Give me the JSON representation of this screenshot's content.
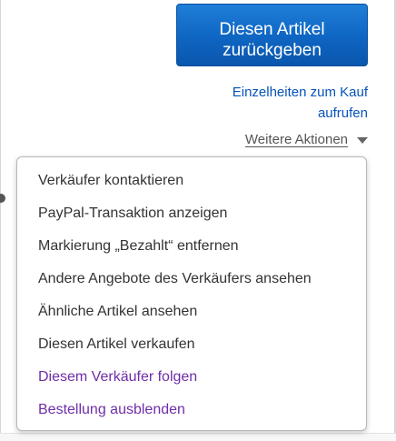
{
  "return_button": {
    "line1": "Diesen Artikel",
    "line2": "zurückgeben"
  },
  "details_link": {
    "line1": "Einzelheiten zum Kauf",
    "line2": "aufrufen"
  },
  "more_actions": {
    "label": "Weitere Aktionen"
  },
  "menu": {
    "items": [
      {
        "label": "Verkäufer kontaktieren",
        "color": "#333333"
      },
      {
        "label": "PayPal-Transaktion anzeigen",
        "color": "#333333"
      },
      {
        "label": "Markierung „Bezahlt“ entfernen",
        "color": "#333333"
      },
      {
        "label": "Andere Angebote des Verkäufers ansehen",
        "color": "#333333"
      },
      {
        "label": "Ähnliche Artikel ansehen",
        "color": "#333333"
      },
      {
        "label": "Diesen Artikel verkaufen",
        "color": "#333333"
      },
      {
        "label": "Diesem Verkäufer folgen",
        "color": "#6f2da8"
      },
      {
        "label": "Bestellung ausblenden",
        "color": "#6f2da8"
      }
    ]
  },
  "colors": {
    "button_blue": "#0f67c4",
    "link_blue": "#0654ba",
    "menu_purple": "#6f2da8"
  }
}
